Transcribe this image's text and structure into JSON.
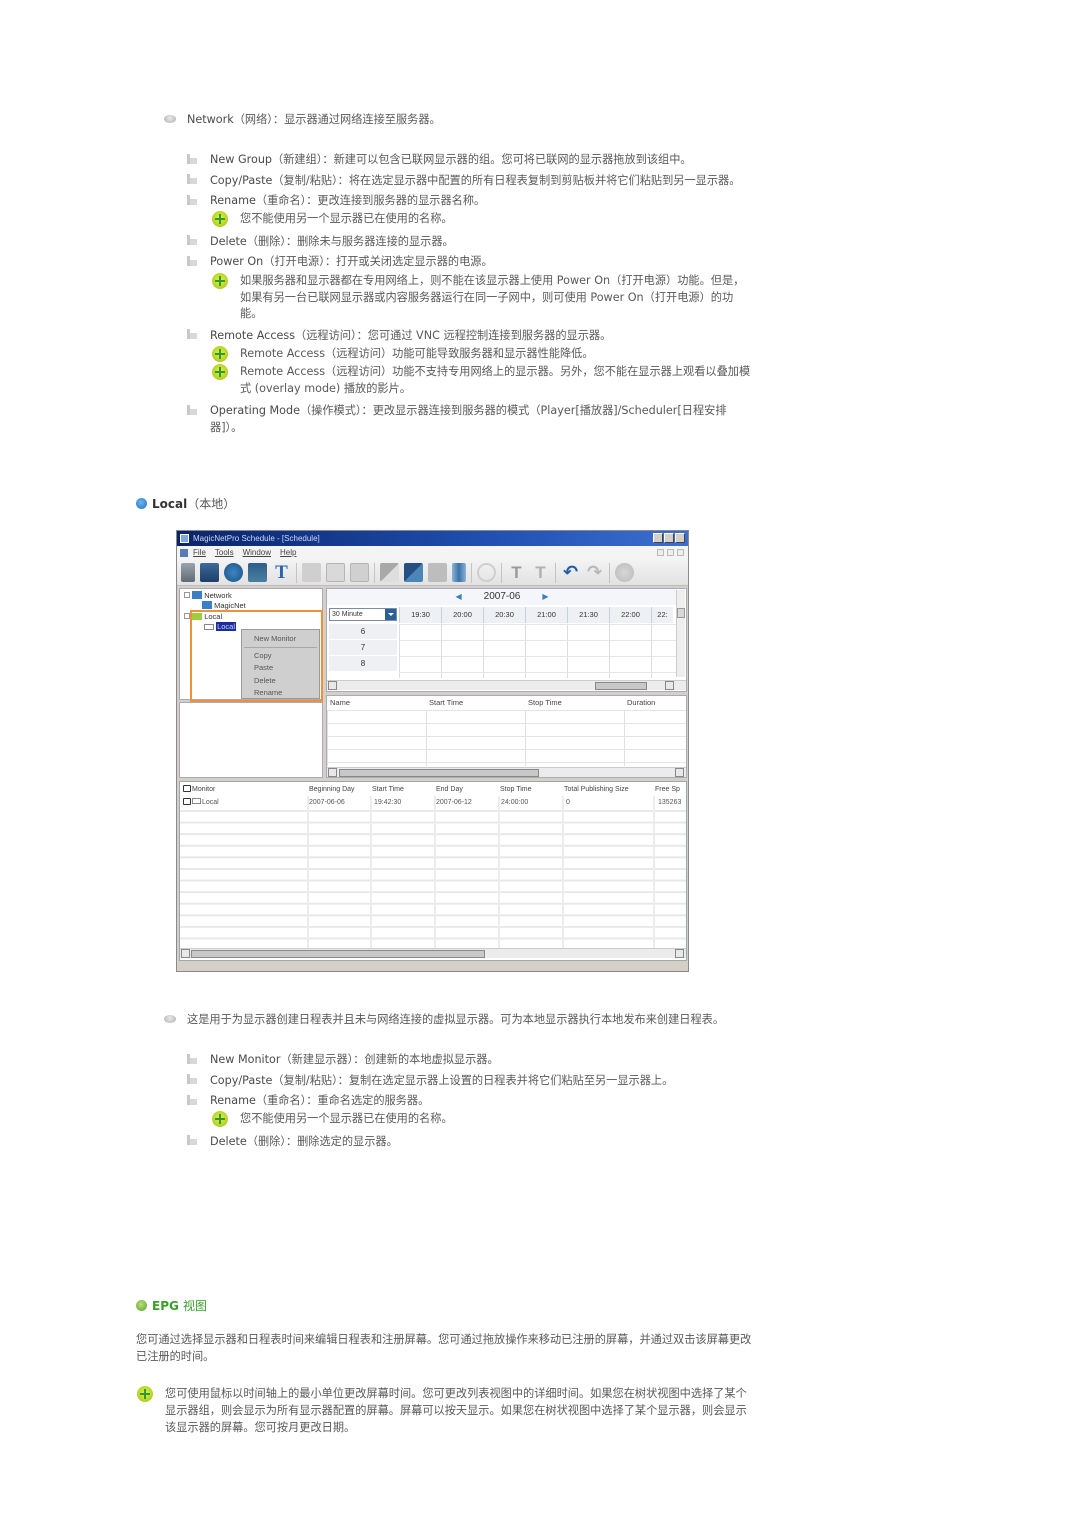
{
  "network_section": {
    "intro": {
      "term": "Network",
      "cn_term": "（网络）",
      "desc": "：显示器通过网络连接至服务器。"
    },
    "items": [
      {
        "term": "New Group",
        "cn_term": "（新建组）",
        "desc": "：新建可以包含已联网显示器的组。您可将已联网的显示器拖放到该组中。"
      },
      {
        "term": "Copy/Paste",
        "cn_term": "（复制/粘贴）",
        "desc": "：将在选定显示器中配置的所有日程表复制到剪贴板并将它们粘贴到另一显示器。"
      },
      {
        "term": "Rename",
        "cn_term": "（重命名）",
        "desc": "：更改连接到服务器的显示器名称。"
      },
      {
        "term": "Delete",
        "cn_term": "（删除）",
        "desc": "：删除未与服务器连接的显示器。"
      },
      {
        "term": "Power On",
        "cn_term": "（打开电源）",
        "desc": "：打开或关闭选定显示器的电源。"
      },
      {
        "term": "Remote Access",
        "cn_term": "（远程访问）",
        "desc": "：您可通过 VNC 远程控制连接到服务器的显示器。"
      },
      {
        "term": "Operating Mode",
        "cn_term": "（操作模式）",
        "desc_line1": "：更改显示器连接到服务器的模式（Player[播放器]/Scheduler[日程安排",
        "desc_line2": "器]）。"
      }
    ],
    "notes": {
      "rename": "您不能使用另一个显示器已在使用的名称。",
      "power_on_line1": "如果服务器和显示器都在专用网络上，则不能在该显示器上使用 Power On（打开电源）功能。但是，",
      "power_on_line2": "如果有另一台已联网显示器或内容服务器运行在同一子网中，则可使用 Power On（打开电源）的功",
      "power_on_line3": "能。",
      "remote_1": "Remote Access（远程访问）功能可能导致服务器和显示器性能降低。",
      "remote_2_line1": "Remote Access（远程访问）功能不支持专用网络上的显示器。另外，您不能在显示器上观看以叠加模",
      "remote_2_line2": "式 (overlay mode) 播放的影片。"
    }
  },
  "local_heading": {
    "term": "Local",
    "cn": "（本地）"
  },
  "app_window": {
    "title": "MagicNetPro Schedule - [Schedule]",
    "menu": [
      "File",
      "Tools",
      "Window",
      "Help"
    ],
    "toolbar_icons": [
      "server-icon",
      "monitor-icon",
      "globe-icon",
      "refresh-monitor-icon",
      "text-icon",
      "image-icon",
      "print-icon",
      "screen-icon",
      "add-screen-icon",
      "copy-screen-icon",
      "move-icon",
      "delete-icon",
      "settings-icon",
      "text-tool-icon",
      "text-format-icon",
      "undo-icon",
      "redo-icon",
      "info-icon"
    ],
    "tree": {
      "network": "Network",
      "magicnet": "MagicNet",
      "local": "Local",
      "local_child": "Local"
    },
    "context_menu": [
      "New Monitor",
      "Copy",
      "Paste",
      "Delete",
      "Rename"
    ],
    "schedule": {
      "month": "2007-06",
      "interval": "30 Minute",
      "times": [
        "19:30",
        "20:00",
        "20:30",
        "21:00",
        "21:30",
        "22:00",
        "22:"
      ],
      "rows": [
        "6",
        "7",
        "8"
      ]
    },
    "event_list": {
      "columns": [
        "Name",
        "Start Time",
        "Stop Time",
        "Duration"
      ]
    },
    "monitor_list": {
      "columns": [
        "Monitor",
        "Beginning Day",
        "Start Time",
        "End Day",
        "Stop Time",
        "Total Publishing Size",
        "Free Sp"
      ],
      "rows": [
        {
          "monitor": "Local",
          "beginning_day": "2007-06-06",
          "start_time": "19:42:30",
          "end_day": "2007-06-12",
          "stop_time": "24:00:00",
          "total_size": "0",
          "free_space": "135263"
        }
      ]
    }
  },
  "local_section": {
    "intro": "这是用于为显示器创建日程表并且未与网络连接的虚拟显示器。可为本地显示器执行本地发布来创建日程表。",
    "items": [
      {
        "term": "New Monitor",
        "cn_term": "（新建显示器）",
        "desc": "：创建新的本地虚拟显示器。"
      },
      {
        "term": "Copy/Paste",
        "cn_term": "（复制/粘贴）",
        "desc": "：复制在选定显示器上设置的日程表并将它们粘贴至另一显示器上。"
      },
      {
        "term": "Rename",
        "cn_term": "（重命名）",
        "desc": "：重命名选定的服务器。"
      },
      {
        "term": "Delete",
        "cn_term": "（删除）",
        "desc": "：删除选定的显示器。"
      }
    ],
    "rename_note": "您不能使用另一个显示器已在使用的名称。"
  },
  "epg": {
    "heading_en": "EPG",
    "heading_cn": "视图",
    "para_line1": "您可通过选择显示器和日程表时间来编辑日程表和注册屏幕。您可通过拖放操作来移动已注册的屏幕，并通过双击该屏幕更改",
    "para_line2": "已注册的时间。",
    "note_line1": "您可使用鼠标以时间轴上的最小单位更改屏幕时间。您可更改列表视图中的详细时间。如果您在树状视图中选择了某个",
    "note_line2": "显示器组，则会显示为所有显示器配置的屏幕。屏幕可以按天显示。如果您在树状视图中选择了某个显示器，则会显示",
    "note_line3": "该显示器的屏幕。您可按月更改日期。"
  }
}
